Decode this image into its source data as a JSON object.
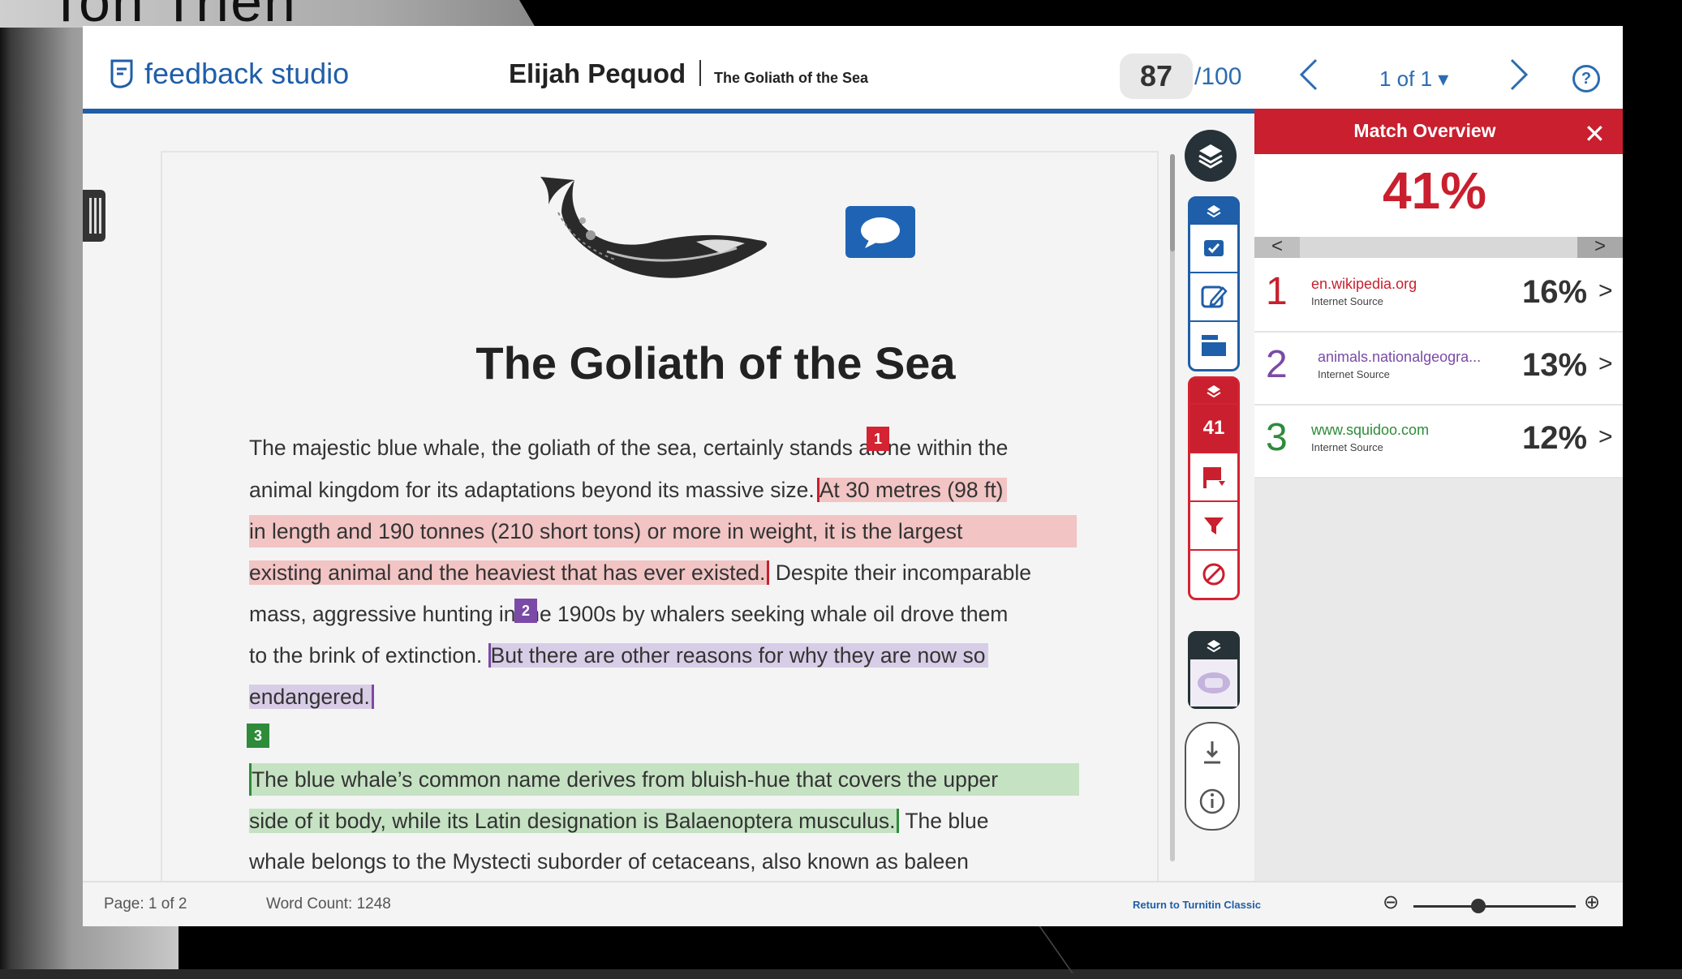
{
  "background": {
    "partial_heading": "Ton Trien"
  },
  "header": {
    "logo_text": "feedback studio",
    "student_name": "Elijah Pequod",
    "paper_title": "The Goliath of the Sea",
    "score": "87",
    "score_total": "/100",
    "pager": "1 of 1 ▾",
    "help": "?"
  },
  "document": {
    "title": "The Goliath of the Sea",
    "markers": {
      "m1": "1",
      "m2": "2",
      "m3": "3"
    },
    "lines": {
      "l1": "The majestic blue whale, the goliath of the sea, certainly stands alone within the",
      "l2a": "animal kingdom for its adaptations beyond its massive size.",
      "l2b": "At 30 metres (98 ft)",
      "l3": "in length and 190 tonnes (210 short tons) or more in weight, it is the largest",
      "l4a": "existing animal and the heaviest that has ever existed.",
      "l4b": "Despite their incomparable",
      "l5": "mass, aggressive hunting in the 1900s by whalers seeking whale oil drove them",
      "l6a": "to the brink of extinction.",
      "l6b": "But there are other reasons for why they are now so",
      "l7": "endangered.",
      "l8": "The blue whale’s common name derives from bluish-hue that covers the upper",
      "l9a": "side of it body, while its Latin designation is Balaenoptera musculus.",
      "l9b": "The blue",
      "l10": "whale belongs to the Mystecti suborder of cetaceans, also known as baleen"
    }
  },
  "toolbar": {
    "similarity_score": "41",
    "icons": [
      "layers-icon",
      "check-icon",
      "edit-icon",
      "window-icon",
      "flag-icon",
      "filter-icon",
      "exclude-icon",
      "download-icon",
      "info-icon"
    ]
  },
  "panel": {
    "title": "Match Overview",
    "close": "✕",
    "total": "41%",
    "prev": "<",
    "next": ">",
    "sources": [
      {
        "num": "1",
        "name": "en.wikipedia.org",
        "type": "Internet Source",
        "pct": "16%",
        "color": "#c91f2e"
      },
      {
        "num": "2",
        "name": "animals.nationalgeogra...",
        "type": "Internet Source",
        "pct": "13%",
        "color": "#7b4aa6"
      },
      {
        "num": "3",
        "name": "www.squidoo.com",
        "type": "Internet Source",
        "pct": "12%",
        "color": "#2e8b3a"
      }
    ]
  },
  "footer": {
    "page": "Page: 1 of 2",
    "word_count": "Word Count: 1248",
    "return_link": "Return to Turnitin Classic",
    "zoom_out": "⊖",
    "zoom_in": "⊕",
    "zoom_level": 0.4
  },
  "colors": {
    "brand_blue": "#1f5ea8",
    "match_red": "#c91f2e",
    "match_purple": "#7b4aa6",
    "match_green": "#2e8b3a"
  }
}
